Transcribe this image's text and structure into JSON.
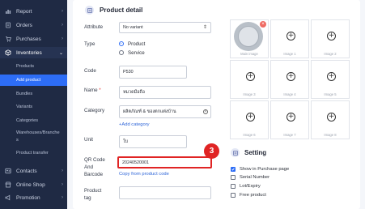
{
  "sidebar": {
    "items": [
      {
        "label": "Report",
        "icon": "report-icon"
      },
      {
        "label": "Orders",
        "icon": "orders-icon"
      },
      {
        "label": "Purchases",
        "icon": "purchases-icon"
      },
      {
        "label": "Inventories",
        "icon": "inventories-icon"
      }
    ],
    "sub_items": [
      "Products",
      "Add product",
      "Bundles",
      "Variants",
      "Categories",
      "Warehouses/Branche",
      "s",
      "Product transfer"
    ],
    "bottom_items": [
      {
        "label": "Contacts",
        "icon": "contacts-icon"
      },
      {
        "label": "Online Shop",
        "icon": "shop-icon"
      },
      {
        "label": "Promotion",
        "icon": "promotion-icon"
      }
    ]
  },
  "product_detail": {
    "title": "Product detail",
    "attribute_label": "Attribute",
    "attribute_value": "No variant",
    "type_label": "Type",
    "type_options": [
      "Product",
      "Service"
    ],
    "type_selected": "Product",
    "code_label": "Code",
    "code_value": "P530",
    "name_label": "Name",
    "name_required": "*",
    "name_value": "หมวดมือถือ",
    "category_label": "Category",
    "category_value": "ผลิตภัณฑ์ & ของตกแต่งบ้าน",
    "add_category_link": "+Add category",
    "unit_label": "Unit",
    "unit_value": "ใบ",
    "qr_label_lines": [
      "QR Code",
      "And",
      "Barcode"
    ],
    "qr_value": "20240520001",
    "copy_code_link": "Copy from product code",
    "product_tag_label_lines": [
      "Product",
      "tag"
    ],
    "step_badge": "3"
  },
  "images": {
    "cells": [
      "Main image",
      "Image 1",
      "Image 2",
      "Image 3",
      "Image 4",
      "Image 5",
      "Image 6",
      "Image 7",
      "Image 8"
    ]
  },
  "setting": {
    "title": "Setting",
    "options": [
      {
        "label": "Show in Purchase page",
        "checked": true
      },
      {
        "label": "Serial Number",
        "checked": false
      },
      {
        "label": "Lot/Expiry",
        "checked": false
      },
      {
        "label": "Free product",
        "checked": false
      }
    ]
  },
  "colors": {
    "sidebar_bg": "#1f2a44",
    "accent": "#2d6df6",
    "highlight": "#e02424"
  }
}
